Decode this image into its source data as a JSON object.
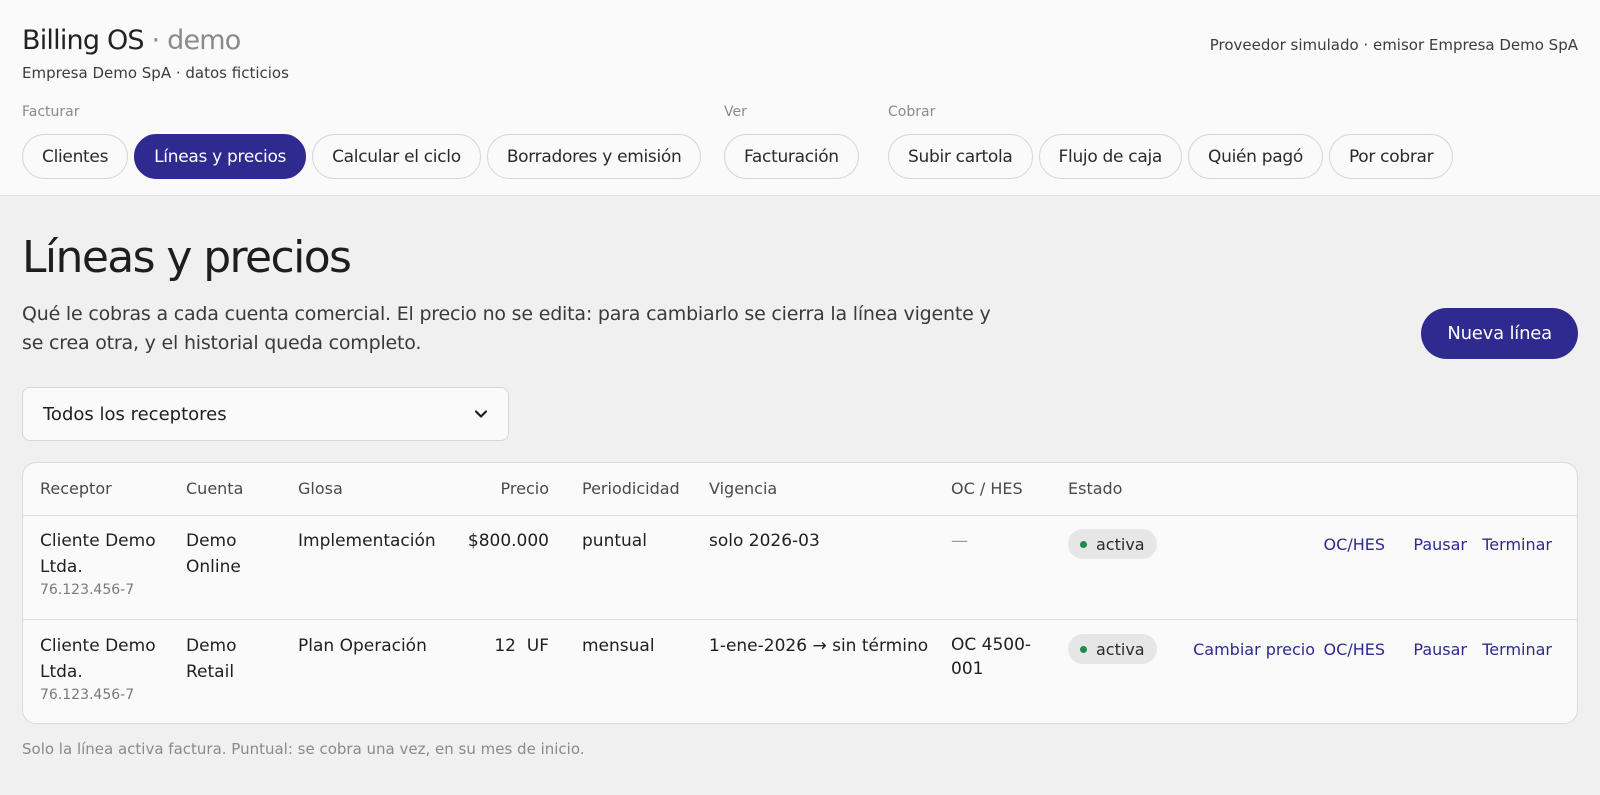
{
  "header": {
    "brand": "Billing OS",
    "brand_separator": "·",
    "env": "demo",
    "subtitle": "Empresa Demo SpA · datos ficticios",
    "provider": "Proveedor simulado · emisor Empresa Demo SpA"
  },
  "nav": {
    "groups": [
      {
        "label": "Facturar",
        "items": [
          {
            "label": "Clientes",
            "active": false
          },
          {
            "label": "Líneas y precios",
            "active": true
          },
          {
            "label": "Calcular el ciclo",
            "active": false
          },
          {
            "label": "Borradores y emisión",
            "active": false
          }
        ]
      },
      {
        "label": "Ver",
        "items": [
          {
            "label": "Facturación",
            "active": false
          }
        ]
      },
      {
        "label": "Cobrar",
        "items": [
          {
            "label": "Subir cartola",
            "active": false
          },
          {
            "label": "Flujo de caja",
            "active": false
          },
          {
            "label": "Quién pagó",
            "active": false
          },
          {
            "label": "Por cobrar",
            "active": false
          }
        ]
      }
    ]
  },
  "page": {
    "title": "Líneas y precios",
    "description": "Qué le cobras a cada cuenta comercial. El precio no se edita: para cambiarlo se cierra la línea vigente y se crea otra, y el historial queda completo.",
    "new_button": "Nueva línea",
    "filter_value": "Todos los receptores",
    "footnote": "Solo la línea activa factura. Puntual: se cobra una vez, en su mes de inicio."
  },
  "table": {
    "headers": {
      "receptor": "Receptor",
      "cuenta": "Cuenta",
      "glosa": "Glosa",
      "precio": "Precio",
      "periodicidad": "Periodicidad",
      "vigencia": "Vigencia",
      "oc_hes": "OC / HES",
      "estado": "Estado"
    },
    "rows": [
      {
        "receptor": "Cliente Demo Ltda.",
        "rut": "76.123.456-7",
        "cuenta": "Demo Online",
        "glosa": "Implementación",
        "precio": "$800.000",
        "periodicidad": "puntual",
        "vigencia": "solo 2026-03",
        "oc_hes": "—",
        "estado": "activa",
        "actions": {
          "oc_hes": "OC/HES",
          "pause": "Pausar",
          "end": "Terminar"
        }
      },
      {
        "receptor": "Cliente Demo Ltda.",
        "rut": "76.123.456-7",
        "cuenta": "Demo Retail",
        "glosa": "Plan Operación",
        "precio": "12  UF",
        "periodicidad": "mensual",
        "vigencia": "1-ene-2026 → sin término",
        "oc_hes": "OC 4500-001",
        "estado": "activa",
        "actions": {
          "change_price": "Cambiar precio",
          "oc_hes": "OC/HES",
          "pause": "Pausar",
          "end": "Terminar"
        }
      }
    ]
  },
  "colors": {
    "accent": "#2e2a8f",
    "status_active": "#1e8a4c",
    "background": "#f0f0f0",
    "surface": "#fafafa"
  },
  "icons": {
    "filter_chevron": "chevron-down-icon",
    "status_dot": "dot-icon"
  }
}
